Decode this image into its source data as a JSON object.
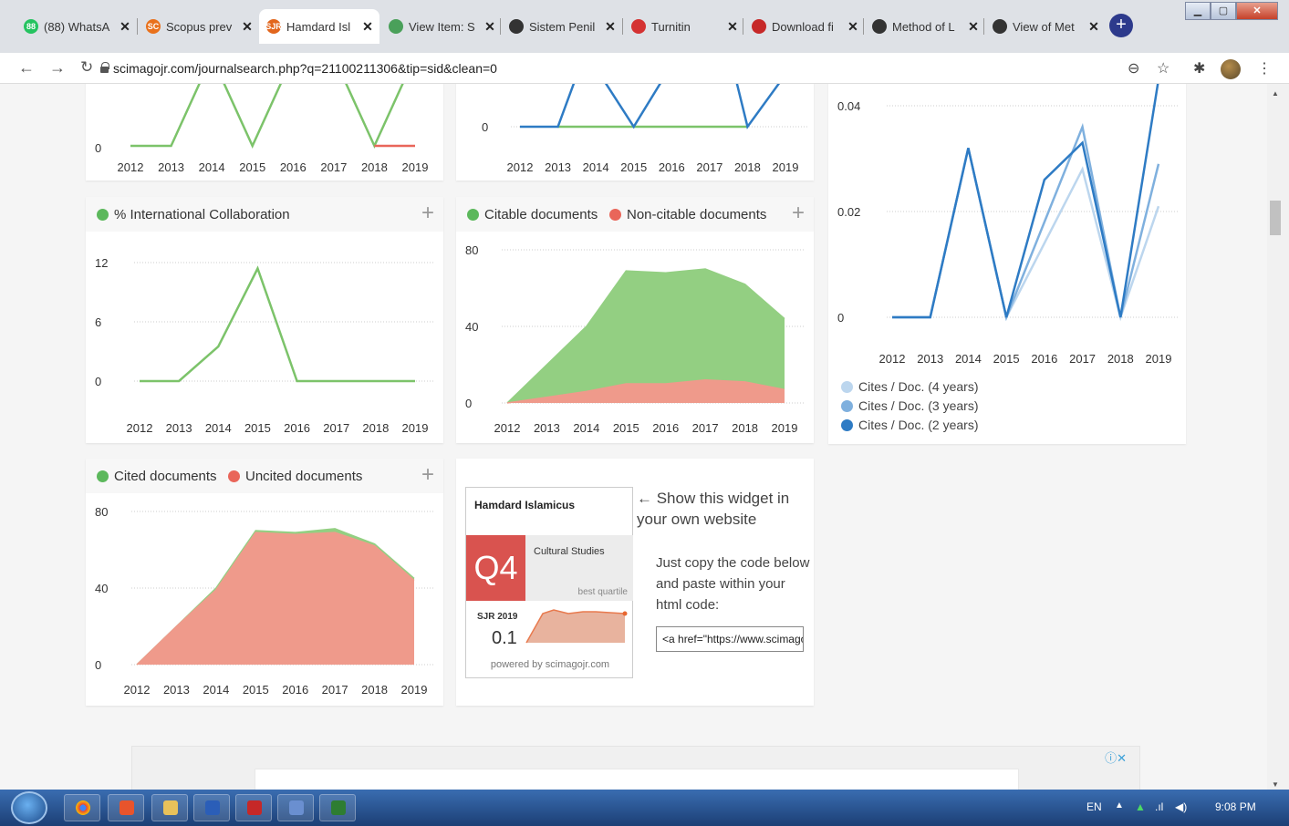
{
  "browser": {
    "tabs": [
      {
        "title": "(88) WhatsA",
        "fav_color": "#25c360",
        "fav_text": "88"
      },
      {
        "title": "Scopus prev",
        "fav_color": "#e9711c",
        "fav_text": "SC"
      },
      {
        "title": "Hamdard Isl",
        "fav_color": "#e2661d",
        "fav_text": "SJR"
      },
      {
        "title": "View Item: S",
        "fav_color": "#4aa05a",
        "fav_text": ""
      },
      {
        "title": "Sistem Penil",
        "fav_color": "#333333",
        "fav_text": ""
      },
      {
        "title": "Turnitin",
        "fav_color": "#d43232",
        "fav_text": ""
      },
      {
        "title": "Download fi",
        "fav_color": "#c62828",
        "fav_text": ""
      },
      {
        "title": "Method of L",
        "fav_color": "#333333",
        "fav_text": ""
      },
      {
        "title": "View of Met",
        "fav_color": "#333333",
        "fav_text": ""
      }
    ],
    "url": "scimagojr.com/journalsearch.php?q=21100211306&tip=sid&clean=0"
  },
  "top_left_chart": {
    "x": [
      "2012",
      "2013",
      "2014",
      "2015",
      "2016",
      "2017",
      "2018",
      "2019"
    ],
    "zero_label": "0"
  },
  "top_mid_chart": {
    "x": [
      "2012",
      "2013",
      "2014",
      "2015",
      "2016",
      "2017",
      "2018",
      "2019"
    ],
    "zero_label": "0"
  },
  "intl_collab": {
    "legend": "% International Collaboration",
    "chart_data": {
      "type": "line",
      "categories": [
        "2012",
        "2013",
        "2014",
        "2015",
        "2016",
        "2017",
        "2018",
        "2019"
      ],
      "series": [
        {
          "name": "% International Collaboration",
          "values": [
            0,
            0,
            3.5,
            11.4,
            0,
            0,
            0,
            0
          ],
          "color": "#7cc36a"
        }
      ],
      "yticks": [
        "0",
        "6",
        "12"
      ],
      "ylim": [
        0,
        12
      ]
    }
  },
  "citable_docs": {
    "legend_a": "Citable documents",
    "legend_b": "Non-citable documents",
    "chart_data": {
      "type": "area",
      "categories": [
        "2012",
        "2013",
        "2014",
        "2015",
        "2016",
        "2017",
        "2018",
        "2019"
      ],
      "series": [
        {
          "name": "Citable documents",
          "values": [
            0,
            20,
            40,
            69,
            68,
            70,
            62,
            44
          ],
          "color": "#93cf82"
        },
        {
          "name": "Non-citable documents",
          "values": [
            0,
            3,
            6,
            10,
            10,
            12,
            11,
            7
          ],
          "color": "#ef9a8b"
        }
      ],
      "yticks": [
        "0",
        "40",
        "80"
      ],
      "ylim": [
        0,
        80
      ]
    }
  },
  "cites_per_doc": {
    "chart_data": {
      "type": "line",
      "categories": [
        "2012",
        "2013",
        "2014",
        "2015",
        "2016",
        "2017",
        "2018",
        "2019"
      ],
      "series": [
        {
          "name": "Cites / Doc. (4 years)",
          "values": [
            0,
            0,
            0.032,
            0,
            0.014,
            0.028,
            0,
            0.021
          ],
          "color": "#bcd6ee"
        },
        {
          "name": "Cites / Doc. (3 years)",
          "values": [
            0,
            0,
            0.032,
            0,
            0.018,
            0.036,
            0,
            0.029
          ],
          "color": "#7fb0de"
        },
        {
          "name": "Cites / Doc. (2 years)",
          "values": [
            0,
            0,
            0.032,
            0,
            0.026,
            0.033,
            0,
            0.045
          ],
          "color": "#2e7bc4"
        }
      ],
      "yticks": [
        "0",
        "0.02",
        "0.04"
      ],
      "ylim": [
        0,
        0.04
      ]
    },
    "legend": [
      "Cites / Doc. (4 years)",
      "Cites / Doc. (3 years)",
      "Cites / Doc. (2 years)"
    ]
  },
  "cited_docs": {
    "legend_a": "Cited documents",
    "legend_b": "Uncited documents",
    "chart_data": {
      "type": "area",
      "categories": [
        "2012",
        "2013",
        "2014",
        "2015",
        "2016",
        "2017",
        "2018",
        "2019"
      ],
      "series": [
        {
          "name": "Cited documents",
          "values": [
            0,
            20,
            40,
            70,
            69,
            71,
            63,
            45
          ],
          "color": "#93cf82"
        },
        {
          "name": "Uncited documents",
          "values": [
            0,
            20,
            39,
            69,
            68,
            69,
            62,
            44
          ],
          "color": "#ef9a8b"
        }
      ],
      "yticks": [
        "0",
        "40",
        "80"
      ],
      "ylim": [
        0,
        80
      ]
    }
  },
  "widget": {
    "journal": "Hamdard Islamicus",
    "quartile": "Q4",
    "category": "Cultural Studies",
    "best_quartile": "best quartile",
    "sjr_label": "SJR 2019",
    "sjr_value": "0.1",
    "powered": "powered by scimagojr.com",
    "side_text": "← Show this widget in your own website",
    "copy_text": "Just copy the code below and paste within your html code:",
    "code": "<a href=\"https://www.scimagojr.com"
  },
  "taskbar": {
    "lang": "EN",
    "time": "9:08 PM"
  }
}
